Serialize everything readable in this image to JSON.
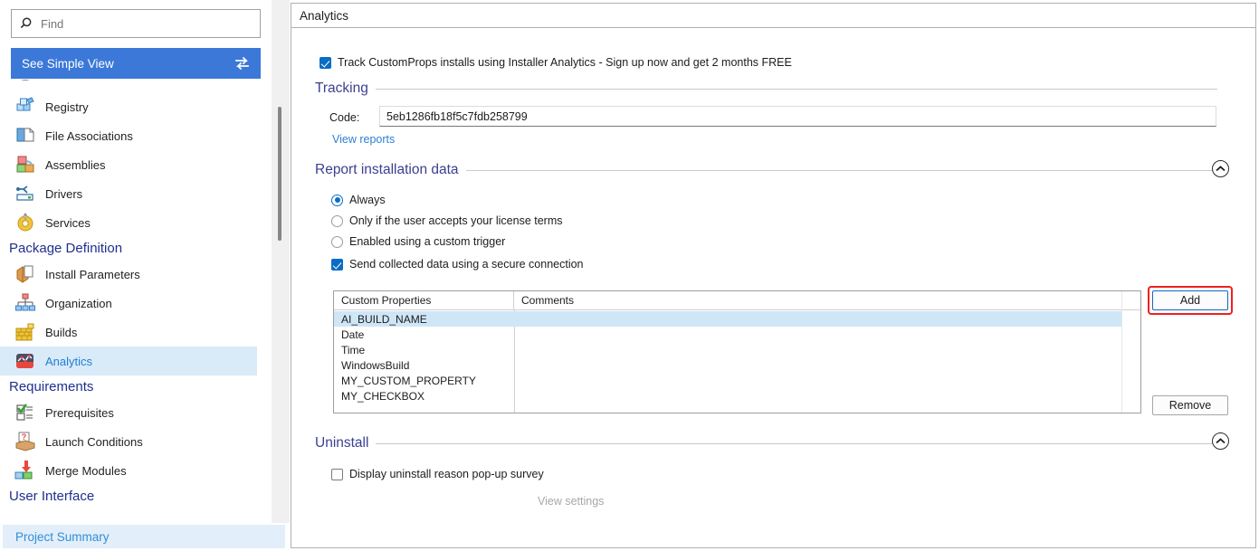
{
  "sidebar": {
    "search": {
      "placeholder": "Find",
      "value": "",
      "icon": "search-icon"
    },
    "simple_view": {
      "label": "See Simple View",
      "icon": "swap-arrows-icon"
    },
    "groups": [
      {
        "header": "",
        "items": [
          {
            "label": "Registry",
            "icon": "registry-icon",
            "selected": false
          },
          {
            "label": "File Associations",
            "icon": "file-associations-icon",
            "selected": false
          },
          {
            "label": "Assemblies",
            "icon": "assemblies-icon",
            "selected": false
          },
          {
            "label": "Drivers",
            "icon": "drivers-icon",
            "selected": false
          },
          {
            "label": "Services",
            "icon": "services-icon",
            "selected": false
          }
        ]
      },
      {
        "header": "Package Definition",
        "items": [
          {
            "label": "Install Parameters",
            "icon": "install-parameters-icon",
            "selected": false
          },
          {
            "label": "Organization",
            "icon": "organization-icon",
            "selected": false
          },
          {
            "label": "Builds",
            "icon": "builds-icon",
            "selected": false
          },
          {
            "label": "Analytics",
            "icon": "analytics-icon",
            "selected": true
          }
        ]
      },
      {
        "header": "Requirements",
        "items": [
          {
            "label": "Prerequisites",
            "icon": "prerequisites-icon",
            "selected": false
          },
          {
            "label": "Launch Conditions",
            "icon": "launch-conditions-icon",
            "selected": false
          },
          {
            "label": "Merge Modules",
            "icon": "merge-modules-icon",
            "selected": false
          }
        ]
      },
      {
        "header": "User Interface",
        "items": []
      }
    ],
    "project_summary": "Project Summary"
  },
  "main": {
    "title": "Analytics",
    "track_checkbox": {
      "label": "Track CustomProps installs using Installer Analytics - Sign up now and get 2 months FREE",
      "checked": true
    },
    "tracking": {
      "section_title": "Tracking",
      "code_label": "Code:",
      "code_value": "5eb1286fb18f5c7fdb258799",
      "view_reports_link": "View reports"
    },
    "report_installation_data": {
      "section_title": "Report installation data",
      "collapse_icon": "chevron-up-icon",
      "options": [
        {
          "label": "Always",
          "type": "radio",
          "checked": true
        },
        {
          "label": "Only if the user accepts your license terms",
          "type": "radio",
          "checked": false
        },
        {
          "label": "Enabled using a custom trigger",
          "type": "radio",
          "checked": false
        },
        {
          "label": "Send collected data using a secure connection",
          "type": "checkbox",
          "checked": true
        }
      ],
      "table": {
        "columns": [
          "Custom Properties",
          "Comments"
        ],
        "rows": [
          {
            "property": "AI_BUILD_NAME",
            "comment": "",
            "selected": true
          },
          {
            "property": "Date",
            "comment": "",
            "selected": false
          },
          {
            "property": "Time",
            "comment": "",
            "selected": false
          },
          {
            "property": "WindowsBuild",
            "comment": "",
            "selected": false
          },
          {
            "property": "MY_CUSTOM_PROPERTY",
            "comment": "",
            "selected": false
          },
          {
            "property": "MY_CHECKBOX",
            "comment": "",
            "selected": false
          }
        ]
      },
      "add_button": "Add",
      "remove_button": "Remove"
    },
    "uninstall": {
      "section_title": "Uninstall",
      "collapse_icon": "chevron-up-icon",
      "survey_checkbox": {
        "label": "Display uninstall reason pop-up survey",
        "checked": false
      },
      "view_settings_link": "View settings"
    }
  },
  "colors": {
    "accent_blue": "#3b78d8",
    "section_title": "#3b3f90",
    "group_header": "#1f2f8f",
    "selected_row": "#d9eaf9",
    "link": "#2f80d4",
    "highlight_red": "#ef2020",
    "table_selected": "#cfe6f7"
  }
}
